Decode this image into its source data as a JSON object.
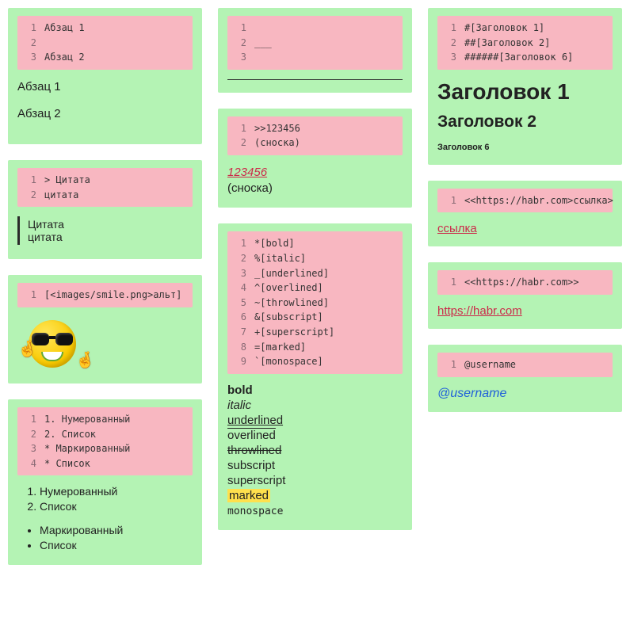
{
  "col1": {
    "paragraphs": {
      "code": [
        "Абзац 1",
        "",
        "Абзац 2"
      ],
      "rendered": [
        "Абзац 1",
        "Абзац 2"
      ]
    },
    "quote": {
      "code": [
        "> Цитата",
        "цитата"
      ],
      "rendered": [
        "Цитата",
        "цитата"
      ]
    },
    "image": {
      "code": [
        "[<images/smile.png>альт]"
      ]
    },
    "lists": {
      "code": [
        "1. Нумерованный",
        "2. Список",
        "* Маркированный",
        "* Список"
      ],
      "ordered": [
        "Нумерованный",
        "Список"
      ],
      "unordered": [
        "Маркированный",
        "Список"
      ]
    }
  },
  "col2": {
    "hr": {
      "code": [
        "",
        "___",
        ""
      ]
    },
    "footnote": {
      "code": [
        ">>123456",
        "(сноска)"
      ],
      "link_text": "123456",
      "note_text": "(сноска)"
    },
    "styles": {
      "code": [
        "*[bold]",
        "%[italic]",
        "_[underlined]",
        "^[overlined]",
        "~[throwlined]",
        "&[subscript]",
        "+[superscript]",
        "=[marked]",
        "`[monospace]"
      ],
      "items": [
        {
          "text": "bold",
          "cls": "sty-bold"
        },
        {
          "text": "italic",
          "cls": "sty-italic"
        },
        {
          "text": "underlined",
          "cls": "sty-under"
        },
        {
          "text": "overlined",
          "cls": "sty-over"
        },
        {
          "text": "throwlined",
          "cls": "sty-through"
        },
        {
          "text": "subscript",
          "cls": ""
        },
        {
          "text": "superscript",
          "cls": ""
        },
        {
          "text": "marked",
          "cls": "sty-mark"
        },
        {
          "text": "monospace",
          "cls": "sty-mono"
        }
      ]
    }
  },
  "col3": {
    "headers": {
      "code": [
        "#[Заголовок 1]",
        "##[Заголовок 2]",
        "######[Заголовок 6]"
      ],
      "h1": "Заголовок 1",
      "h2": "Заголовок 2",
      "h6": "Заголовок 6"
    },
    "link_text": {
      "code": [
        "<<https://habr.com>ссылка>"
      ],
      "text": "ссылка",
      "href": "https://habr.com"
    },
    "link_bare": {
      "code": [
        "<<https://habr.com>>"
      ],
      "text": "https://habr.com",
      "href": "https://habr.com"
    },
    "mention": {
      "code": [
        "@username"
      ],
      "text": "@username"
    }
  }
}
